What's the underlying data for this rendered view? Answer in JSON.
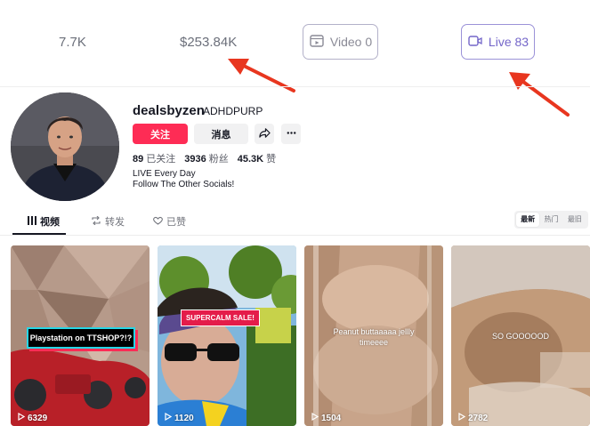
{
  "stats": {
    "followers_short": "7.7K",
    "revenue": "$253.84K",
    "video_label": "Video 0",
    "live_label": "Live 83"
  },
  "profile": {
    "username": "dealsbyzen",
    "nickname": "ADHDPURP",
    "follow_label": "关注",
    "message_label": "消息",
    "following_count": "89",
    "following_label": "已关注",
    "followers_count": "3936",
    "followers_label": "粉丝",
    "likes_count": "45.3K",
    "likes_label": "赞",
    "bio_line1": "LIVE Every Day",
    "bio_line2": "Follow The Other Socials!"
  },
  "tabs": [
    {
      "label": "视频",
      "icon": "grid-icon",
      "active": true
    },
    {
      "label": "转发",
      "icon": "repost-icon",
      "active": false
    },
    {
      "label": "已赞",
      "icon": "heart-icon",
      "active": false
    }
  ],
  "sort": [
    "最新",
    "热门",
    "最旧"
  ],
  "videos": [
    {
      "caption": "Playstation on TTSHOP?!?",
      "views": "6329"
    },
    {
      "caption": "SUPERCALM SALE!",
      "views": "1120"
    },
    {
      "caption": "Peanut buttaaaaa jellly timeeee",
      "views": "1504"
    },
    {
      "caption": "SO GOOOOOD",
      "views": "2782"
    }
  ],
  "colors": {
    "accent": "#fe2c55",
    "arrow": "#e8361f",
    "live_border": "#9b92d8"
  }
}
